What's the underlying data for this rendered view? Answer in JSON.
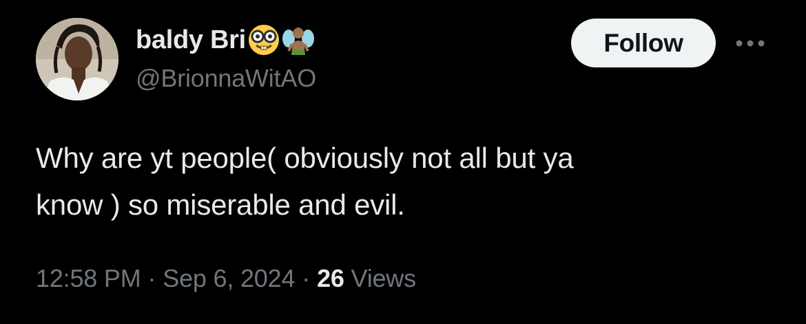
{
  "user": {
    "display_name": "baldy Bri",
    "name_emojis": [
      "nerd-face-emoji",
      "fairy-emoji"
    ],
    "handle": "@BrionnaWitAO"
  },
  "actions": {
    "follow_label": "Follow",
    "more_icon": "more-horizontal-icon"
  },
  "tweet": {
    "lines": [
      "Why are yt people( obviously not all but ya",
      "know ) so miserable and evil."
    ]
  },
  "meta": {
    "time": "12:58 PM",
    "separator": "·",
    "date": "Sep 6, 2024",
    "views_count": "26",
    "views_label": "Views"
  },
  "colors": {
    "background": "#000000",
    "text_primary": "#e7e9ea",
    "text_secondary": "#71767b",
    "follow_button_bg": "#eff3f4",
    "follow_button_text": "#0f1419"
  }
}
